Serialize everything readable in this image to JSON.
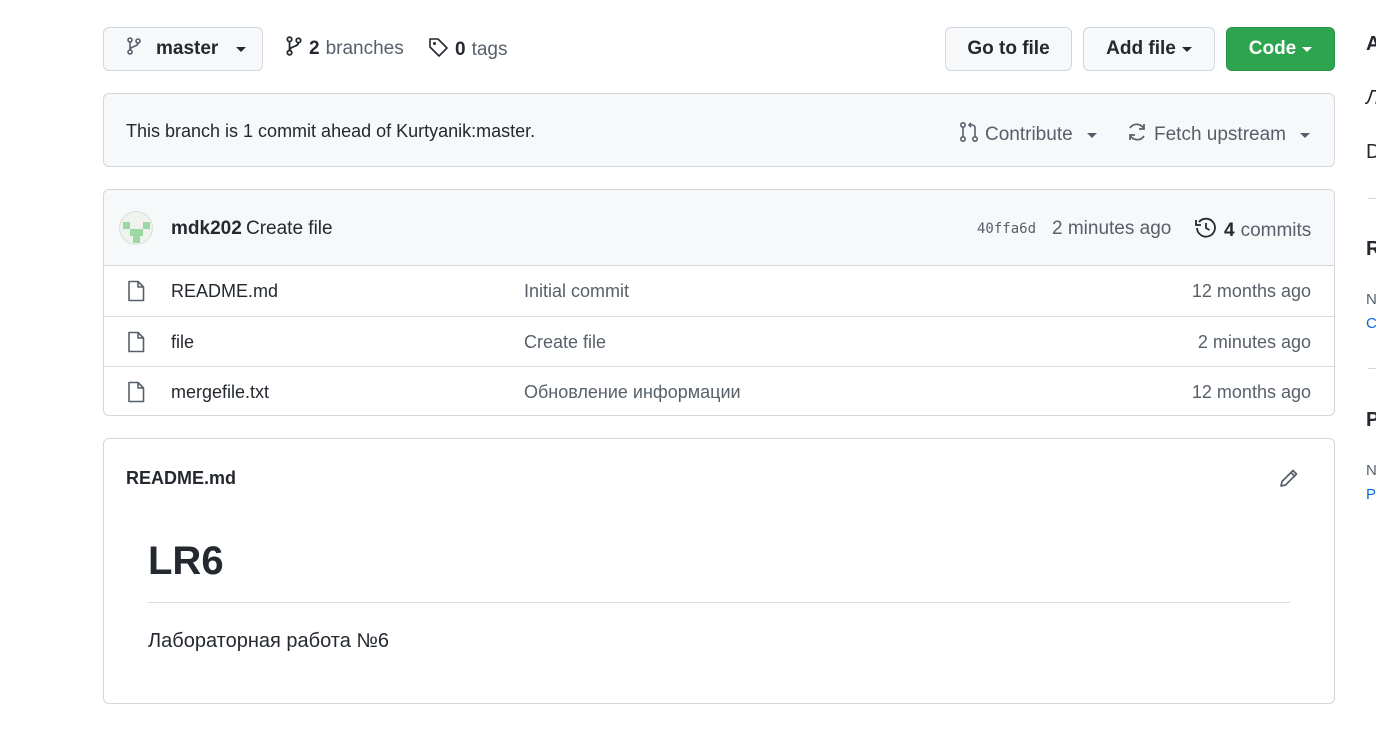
{
  "toolbar": {
    "branch_name": "master",
    "branches_count": "2",
    "branches_label": "branches",
    "tags_count": "0",
    "tags_label": "tags",
    "go_to_file": "Go to file",
    "add_file": "Add file",
    "code": "Code"
  },
  "ahead_bar": {
    "message": "This branch is 1 commit ahead of Kurtyanik:master.",
    "contribute": "Contribute",
    "fetch_upstream": "Fetch upstream"
  },
  "latest_commit": {
    "author": "mdk202",
    "message": "Create file",
    "sha": "40ffa6d",
    "time": "2 minutes ago",
    "commits_count": "4",
    "commits_label": "commits"
  },
  "files": [
    {
      "name": "README.md",
      "message": "Initial commit",
      "time": "12 months ago"
    },
    {
      "name": "file",
      "message": "Create file",
      "time": "2 minutes ago"
    },
    {
      "name": "mergefile.txt",
      "message": "Обновление информации",
      "time": "12 months ago"
    }
  ],
  "readme": {
    "filename": "README.md",
    "heading": "LR6",
    "paragraph": "Лабораторная работа №6"
  },
  "sidebar_fragments": {
    "about_initial": "A",
    "desc_initial": "Л",
    "readme_initial": "D",
    "releases_initial": "R",
    "releases_note_initial": "N",
    "releases_link_initial": "C",
    "packages_initial": "P",
    "packages_note_initial": "N",
    "packages_link_initial": "P"
  },
  "colors": {
    "code_button": "#2da44e",
    "border": "#d0d7de",
    "muted_text": "#57606a",
    "link": "#0969da"
  },
  "icons": [
    "git-branch-icon",
    "tag-icon",
    "git-pull-request-icon",
    "sync-icon",
    "history-icon",
    "file-icon",
    "pencil-icon"
  ]
}
